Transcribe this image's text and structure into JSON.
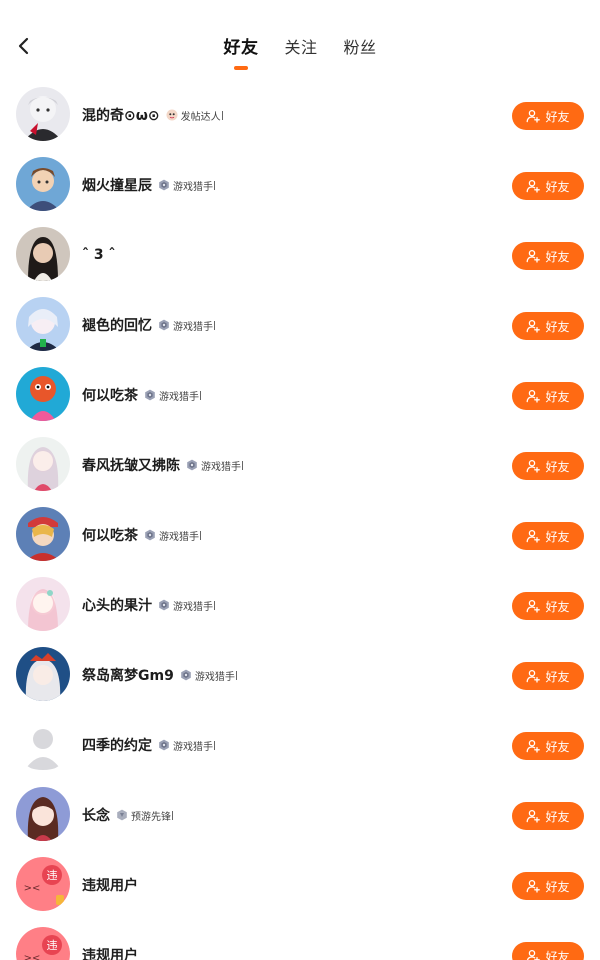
{
  "theme": {
    "accent": "#ff6a13"
  },
  "header": {
    "back_icon": "chevron-left-icon",
    "tabs": [
      {
        "label": "好友",
        "active": true
      },
      {
        "label": "关注",
        "active": false
      },
      {
        "label": "粉丝",
        "active": false
      }
    ]
  },
  "list": [
    {
      "name": "混的奇⊙ω⊙",
      "badge": "发帖达人",
      "badge_icon": "poster-badge-icon",
      "button": "好友",
      "avatar": "a1"
    },
    {
      "name": "烟火撞星辰",
      "badge": "游戏猎手",
      "badge_icon": "hunter-badge-icon",
      "button": "好友",
      "avatar": "a2"
    },
    {
      "name": "ˆ 3 ˆ",
      "badge": "",
      "badge_icon": "",
      "button": "好友",
      "avatar": "a3"
    },
    {
      "name": "褪色的回忆",
      "badge": "游戏猎手",
      "badge_icon": "hunter-badge-icon",
      "button": "好友",
      "avatar": "a4"
    },
    {
      "name": "何以吃茶",
      "badge": "游戏猎手",
      "badge_icon": "hunter-badge-icon",
      "button": "好友",
      "avatar": "a5"
    },
    {
      "name": "春风抚皱又拂陈",
      "badge": "游戏猎手",
      "badge_icon": "hunter-badge-icon",
      "button": "好友",
      "avatar": "a6"
    },
    {
      "name": "何以吃茶",
      "badge": "游戏猎手",
      "badge_icon": "hunter-badge-icon",
      "button": "好友",
      "avatar": "a7"
    },
    {
      "name": "心头的果汁",
      "badge": "游戏猎手",
      "badge_icon": "hunter-badge-icon",
      "button": "好友",
      "avatar": "a8"
    },
    {
      "name": "祭岛离梦Gm9",
      "badge": "游戏猎手",
      "badge_icon": "hunter-badge-icon",
      "button": "好友",
      "avatar": "a9"
    },
    {
      "name": "四季的约定",
      "badge": "游戏猎手",
      "badge_icon": "hunter-badge-icon",
      "button": "好友",
      "avatar": "default"
    },
    {
      "name": "长念",
      "badge": "预游先锋",
      "badge_icon": "pioneer-badge-icon",
      "button": "好友",
      "avatar": "a11"
    },
    {
      "name": "违规用户",
      "badge": "",
      "badge_icon": "",
      "button": "好友",
      "avatar": "violation",
      "avatar_text": "违"
    },
    {
      "name": "违规用户",
      "badge": "",
      "badge_icon": "",
      "button": "好友",
      "avatar": "violation",
      "avatar_text": "违"
    }
  ]
}
